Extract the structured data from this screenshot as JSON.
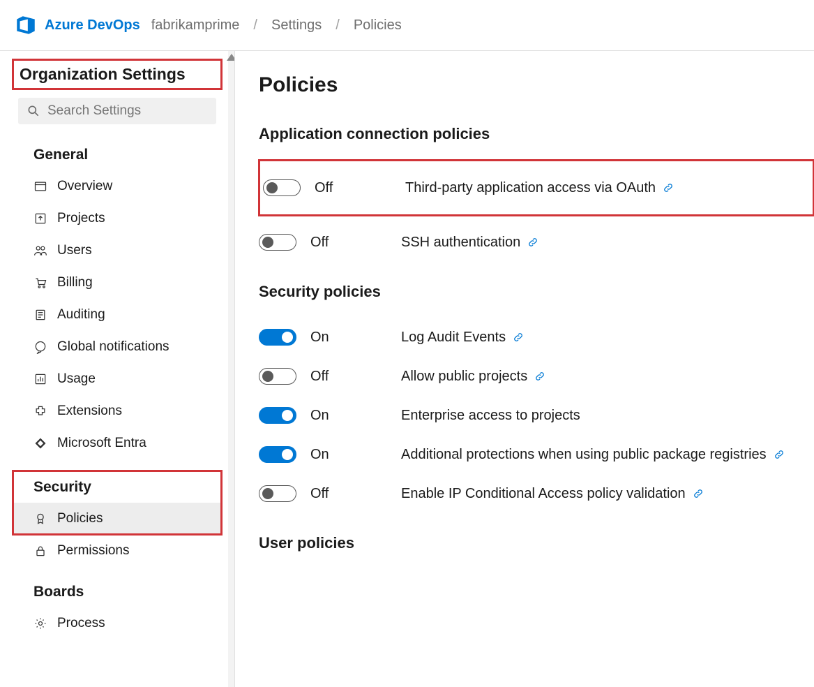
{
  "header": {
    "brand": "Azure DevOps",
    "crumbs": [
      "fabrikamprime",
      "Settings",
      "Policies"
    ]
  },
  "sidebar": {
    "title": "Organization Settings",
    "search_placeholder": "Search Settings",
    "groups": [
      {
        "title": "General",
        "items": [
          {
            "id": "overview",
            "label": "Overview",
            "icon": "card-icon"
          },
          {
            "id": "projects",
            "label": "Projects",
            "icon": "upload-icon"
          },
          {
            "id": "users",
            "label": "Users",
            "icon": "users-icon"
          },
          {
            "id": "billing",
            "label": "Billing",
            "icon": "cart-icon"
          },
          {
            "id": "auditing",
            "label": "Auditing",
            "icon": "list-icon"
          },
          {
            "id": "global-notifications",
            "label": "Global notifications",
            "icon": "chat-icon"
          },
          {
            "id": "usage",
            "label": "Usage",
            "icon": "chart-icon"
          },
          {
            "id": "extensions",
            "label": "Extensions",
            "icon": "puzzle-icon"
          },
          {
            "id": "entra",
            "label": "Microsoft Entra",
            "icon": "entra-icon"
          }
        ]
      },
      {
        "title": "Security",
        "items": [
          {
            "id": "policies",
            "label": "Policies",
            "icon": "badge-icon",
            "selected": true
          },
          {
            "id": "permissions",
            "label": "Permissions",
            "icon": "lock-icon"
          }
        ]
      },
      {
        "title": "Boards",
        "items": [
          {
            "id": "process",
            "label": "Process",
            "icon": "gear-icon"
          }
        ]
      }
    ]
  },
  "main": {
    "title": "Policies",
    "sections": [
      {
        "title": "Application connection policies",
        "policies": [
          {
            "on": false,
            "state": "Off",
            "label": "Third-party application access via OAuth",
            "link": true,
            "highlight": true
          },
          {
            "on": false,
            "state": "Off",
            "label": "SSH authentication",
            "link": true
          }
        ]
      },
      {
        "title": "Security policies",
        "policies": [
          {
            "on": true,
            "state": "On",
            "label": "Log Audit Events",
            "link": true
          },
          {
            "on": false,
            "state": "Off",
            "label": "Allow public projects",
            "link": true
          },
          {
            "on": true,
            "state": "On",
            "label": "Enterprise access to projects",
            "link": false
          },
          {
            "on": true,
            "state": "On",
            "label": "Additional protections when using public package registries",
            "link": true
          },
          {
            "on": false,
            "state": "Off",
            "label": "Enable IP Conditional Access policy validation",
            "link": true
          }
        ]
      },
      {
        "title": "User policies",
        "policies": []
      }
    ]
  }
}
